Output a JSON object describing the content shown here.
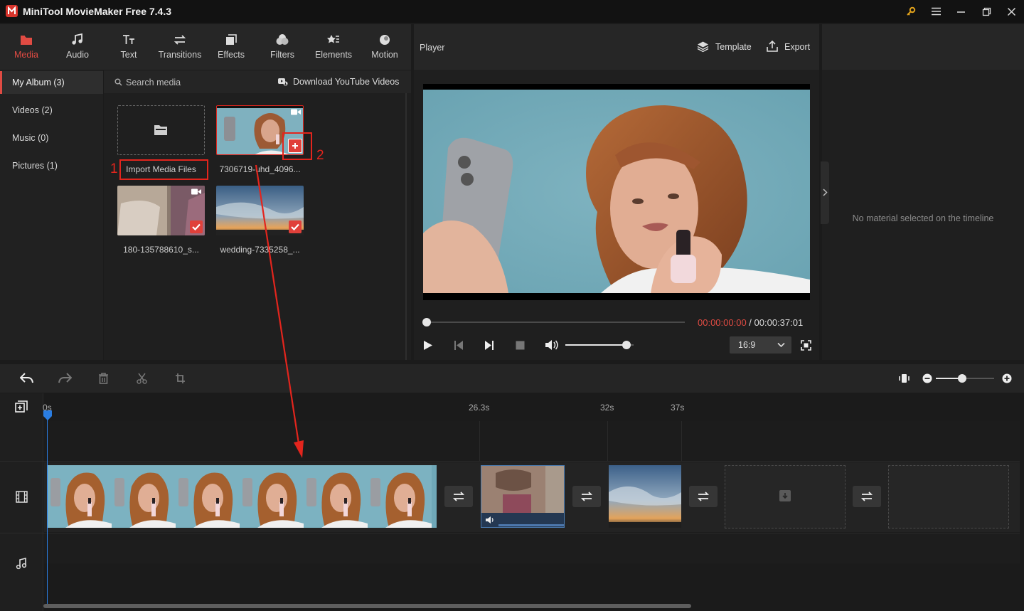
{
  "app": {
    "title": "MiniTool MovieMaker Free 7.4.3"
  },
  "toolbar": {
    "tabs": [
      {
        "label": "Media",
        "icon": "media-folder-icon"
      },
      {
        "label": "Audio",
        "icon": "music-note-icon"
      },
      {
        "label": "Text",
        "icon": "text-icon"
      },
      {
        "label": "Transitions",
        "icon": "transitions-icon"
      },
      {
        "label": "Effects",
        "icon": "effects-icon"
      },
      {
        "label": "Filters",
        "icon": "filters-icon"
      },
      {
        "label": "Elements",
        "icon": "elements-icon"
      },
      {
        "label": "Motion",
        "icon": "motion-icon"
      }
    ],
    "active": "Media"
  },
  "sidebar": {
    "items": [
      {
        "label": "My Album (3)"
      },
      {
        "label": "Videos (2)"
      },
      {
        "label": "Music (0)"
      },
      {
        "label": "Pictures (1)"
      }
    ]
  },
  "media": {
    "search_placeholder": "Search media",
    "download_label": "Download YouTube Videos",
    "import_label": "Import Media Files",
    "items": [
      {
        "caption": "7306719-uhd_4096...",
        "type": "video"
      },
      {
        "caption": "180-135788610_s...",
        "type": "video"
      },
      {
        "caption": "wedding-7335258_...",
        "type": "image"
      }
    ]
  },
  "player": {
    "title": "Player",
    "template_label": "Template",
    "export_label": "Export",
    "current_time": "00:00:00:00",
    "time_separator": " / ",
    "total_time": "00:00:37:01",
    "aspect_ratio": "16:9",
    "progress": 0,
    "volume": 0.9
  },
  "properties": {
    "empty_text": "No material selected on the timeline"
  },
  "timeline": {
    "ruler": [
      "0s",
      "26.3s",
      "32s",
      "37s"
    ],
    "zoom": 0.45
  },
  "annotations": {
    "step1": "1",
    "step2": "2"
  },
  "colors": {
    "accent": "#e04b43",
    "annotation": "#e3251d",
    "playhead": "#2a7de1"
  }
}
